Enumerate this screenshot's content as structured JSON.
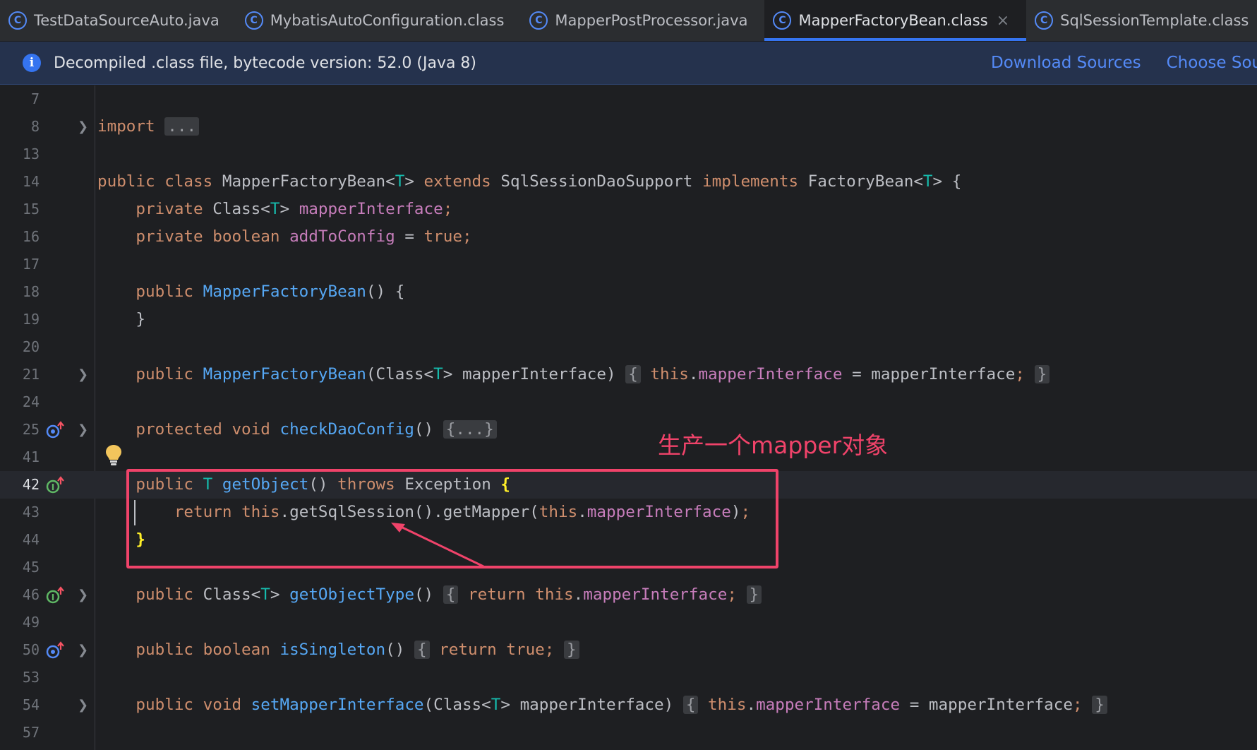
{
  "tabs": [
    {
      "label": "TestDataSourceAuto.java",
      "icon": "class-icon",
      "active": false
    },
    {
      "label": "MybatisAutoConfiguration.class",
      "icon": "class-icon",
      "active": false
    },
    {
      "label": "MapperPostProcessor.java",
      "icon": "class-icon",
      "active": false
    },
    {
      "label": "MapperFactoryBean.class",
      "icon": "class-icon",
      "active": true
    },
    {
      "label": "SqlSessionTemplate.class",
      "icon": "class-icon",
      "active": false
    }
  ],
  "banner": {
    "message": "Decompiled .class file, bytecode version: 52.0 (Java 8)",
    "download_sources": "Download Sources",
    "choose_sources": "Choose Sources..."
  },
  "annotation": "生产一个mapper对象",
  "line_numbers": [
    "7",
    "8",
    "13",
    "14",
    "15",
    "16",
    "17",
    "18",
    "19",
    "20",
    "21",
    "24",
    "25",
    "41",
    "42",
    "43",
    "44",
    "45",
    "46",
    "49",
    "50",
    "53",
    "54",
    "57"
  ],
  "code": {
    "l8_kw": "import",
    "l8_fold": "...",
    "l14_kw1": "public class",
    "l14_name": "MapperFactoryBean",
    "l14_lt": "<",
    "l14_t": "T",
    "l14_gt": ">",
    "l14_kw2": "extends",
    "l14_super": "SqlSessionDaoSupport",
    "l14_kw3": "implements",
    "l14_iface": "FactoryBean",
    "l14_lt2": "<",
    "l14_t2": "T",
    "l14_gt2": "> {",
    "l15_kw": "private",
    "l15_type": "Class<",
    "l15_t": "T",
    "l15_gt": "> ",
    "l15_field": "mapperInterface",
    "l15_semi": ";",
    "l16_kw": "private boolean",
    "l16_field": "addToConfig",
    "l16_eq": " = ",
    "l16_val": "true",
    "l16_semi": ";",
    "l18_kw": "public",
    "l18_fn": "MapperFactoryBean",
    "l18_rest": "() {",
    "l19": "}",
    "l21_kw": "public",
    "l21_fn": "MapperFactoryBean",
    "l21_p1": "(Class<",
    "l21_t": "T",
    "l21_p2": "> mapperInterface)",
    "l21_ob": "{",
    "l21_this": "this",
    "l21_dot": ".",
    "l21_field": "mapperInterface",
    "l21_assign": " = mapperInterface",
    "l21_semi": ";",
    "l21_cb": "}",
    "l25_kw": "protected void",
    "l25_fn": "checkDaoConfig",
    "l25_paren": "()",
    "l25_fold": "{...}",
    "l42_kw": "public",
    "l42_t": "T",
    "l42_fn": "getObject",
    "l42_paren": "()",
    "l42_throws": "throws",
    "l42_exc": "Exception",
    "l42_brace": "{",
    "l43_ret": "return",
    "l43_this": "this",
    "l43_call1": ".getSqlSession().getMapper(",
    "l43_this2": "this",
    "l43_dot": ".",
    "l43_field": "mapperInterface",
    "l43_end": ")",
    "l43_semi": ";",
    "l44_brace": "}",
    "l46_kw": "public",
    "l46_type": "Class<",
    "l46_t": "T",
    "l46_gt": "> ",
    "l46_fn": "getObjectType",
    "l46_paren": "()",
    "l46_ob": "{",
    "l46_ret": "return",
    "l46_this": "this",
    "l46_dot": ".",
    "l46_field": "mapperInterface",
    "l46_semi": ";",
    "l46_cb": "}",
    "l50_kw": "public boolean",
    "l50_fn": "isSingleton",
    "l50_paren": "()",
    "l50_ob": "{",
    "l50_ret": "return true",
    "l50_semi": ";",
    "l50_cb": "}",
    "l54_kw": "public void",
    "l54_fn": "setMapperInterface",
    "l54_p1": "(Class<",
    "l54_t": "T",
    "l54_p2": "> mapperInterface)",
    "l54_ob": "{",
    "l54_this": "this",
    "l54_dot": ".",
    "l54_field": "mapperInterface",
    "l54_assign": " = mapperInterface",
    "l54_semi": ";",
    "l54_cb": "}"
  },
  "colors": {
    "accent": "#3574f0",
    "annotation": "#f0436a",
    "keyword": "#cf8e6d",
    "function": "#56a8f5",
    "field": "#c77dbb",
    "type_param": "#16baac"
  }
}
